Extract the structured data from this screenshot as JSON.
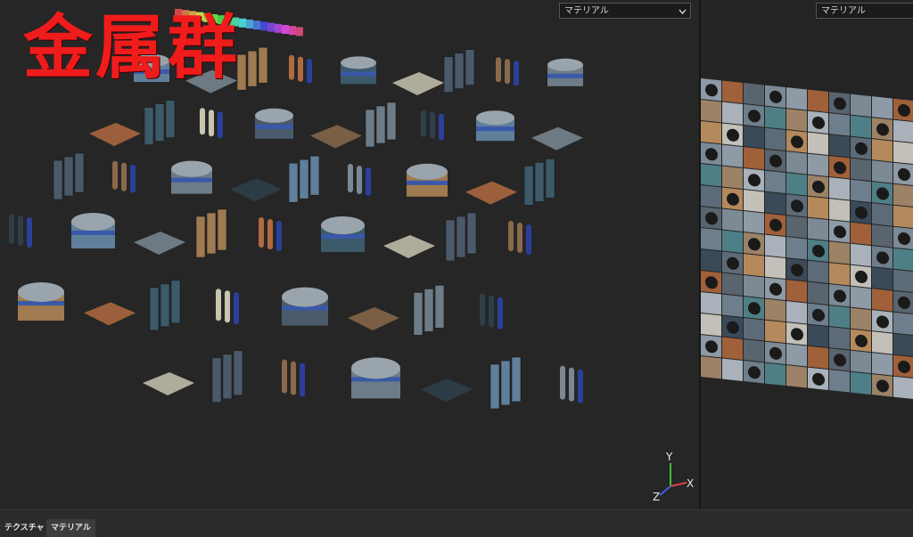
{
  "viewport": {
    "overlay_title": "金属群",
    "material_dropdown": {
      "selected": "マテリアル"
    },
    "axis_labels": {
      "y": "Y",
      "x": "X",
      "z": "Z"
    }
  },
  "uv_panel": {
    "material_dropdown": {
      "selected": "マテリアル"
    }
  },
  "bottom_tabs": [
    {
      "label": "テクスチャ"
    },
    {
      "label": "マテリアル"
    }
  ],
  "colors": {
    "title_red": "#f01c1c",
    "axis_x": "#e04040",
    "axis_y": "#40c040",
    "axis_z": "#4060e0",
    "dropdown_text": "#4aa3ff"
  },
  "icons": [
    "chevron-down-icon",
    "axis-gizmo-icon"
  ]
}
